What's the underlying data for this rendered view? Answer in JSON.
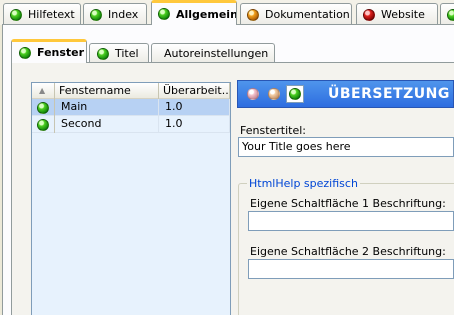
{
  "top_tabs": [
    {
      "label": "Hilfetext",
      "status": "green",
      "icon": "status-green-icon"
    },
    {
      "label": "Index",
      "status": "green",
      "icon": "status-green-icon"
    },
    {
      "label": "Allgemein",
      "status": "green",
      "icon": "status-green-icon",
      "active": true
    },
    {
      "label": "Dokumentation",
      "status": "orange",
      "icon": "status-orange-icon"
    },
    {
      "label": "Website",
      "status": "red",
      "icon": "status-red-icon"
    },
    {
      "label": "E",
      "status": "green",
      "icon": "status-green-icon"
    }
  ],
  "sub_tabs": [
    {
      "label": "Fenster",
      "status": "green",
      "active": true
    },
    {
      "label": "Titel",
      "status": "green"
    },
    {
      "label": "Autoreinstellungen"
    }
  ],
  "window_grid": {
    "sort_glyph": "▲",
    "columns": [
      "Fenstername",
      "Überarbeit..."
    ],
    "rows": [
      {
        "name": "Main",
        "revision": "1.0",
        "status": "green",
        "selected": true
      },
      {
        "name": "Second",
        "revision": "1.0",
        "status": "green",
        "selected": false
      }
    ]
  },
  "translation_header": {
    "title": "ÜBERSETZUNG",
    "indicators": [
      "pink",
      "peach",
      "green"
    ]
  },
  "window_title": {
    "label": "Fenstertitel:",
    "value": "Your Title goes here"
  },
  "htmlhelp_group": {
    "title": "HtmlHelp spezifisch",
    "button1_label": "Eigene Schaltfläche 1 Beschriftung:",
    "button1_value": "",
    "button2_label": "Eigene Schaltfläche 2 Beschriftung:",
    "button2_value": ""
  },
  "colors": {
    "accent_tab": "#ffc83c",
    "header_blue": "#2d6de0",
    "selection": "#b7d1f3",
    "group_title": "#0046d5"
  }
}
